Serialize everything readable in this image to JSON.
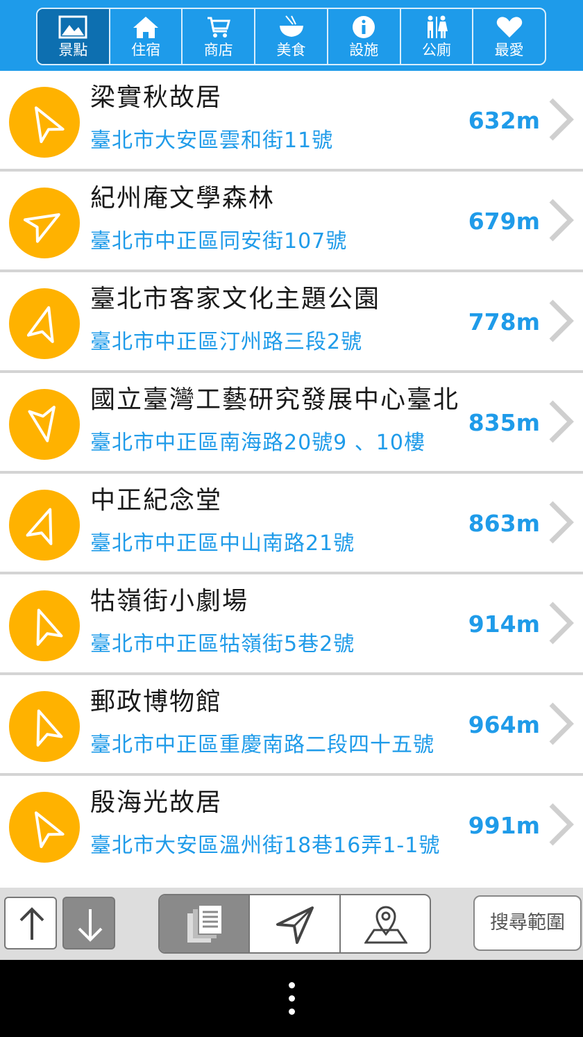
{
  "tabs": [
    {
      "label": "景點",
      "icon": "landscape-icon",
      "active": true
    },
    {
      "label": "住宿",
      "icon": "home-icon",
      "active": false
    },
    {
      "label": "商店",
      "icon": "cart-icon",
      "active": false
    },
    {
      "label": "美食",
      "icon": "bowl-icon",
      "active": false
    },
    {
      "label": "設施",
      "icon": "info-icon",
      "active": false
    },
    {
      "label": "公廁",
      "icon": "restroom-icon",
      "active": false
    },
    {
      "label": "最愛",
      "icon": "heart-icon",
      "active": false
    }
  ],
  "places": [
    {
      "name": "梁實秋故居",
      "address": "臺北市大安區雲和街11號",
      "distance": "632m",
      "direction_deg": -30
    },
    {
      "name": "紀州庵文學森林",
      "address": "臺北市中正區同安街107號",
      "distance": "679m",
      "direction_deg": 60
    },
    {
      "name": "臺北市客家文化主題公園",
      "address": "臺北市中正區汀州路三段2號",
      "distance": "778m",
      "direction_deg": 15
    },
    {
      "name": "國立臺灣工藝研究發展中心臺北",
      "address": "臺北市中正區南海路20號9 、10樓",
      "distance": "835m",
      "direction_deg": 170
    },
    {
      "name": "中正紀念堂",
      "address": "臺北市中正區中山南路21號",
      "distance": "863m",
      "direction_deg": 20
    },
    {
      "name": "牯嶺街小劇場",
      "address": "臺北市中正區牯嶺街5巷2號",
      "distance": "914m",
      "direction_deg": -20
    },
    {
      "name": "郵政博物館",
      "address": "臺北市中正區重慶南路二段四十五號",
      "distance": "964m",
      "direction_deg": -20
    },
    {
      "name": "殷海光故居",
      "address": "臺北市大安區溫州街18巷16弄1-1號",
      "distance": "991m",
      "direction_deg": -30
    }
  ],
  "toolbar": {
    "scroll_up_icon": "arrow-up-icon",
    "scroll_down_icon": "arrow-down-icon",
    "segments": [
      {
        "icon": "list-icon",
        "active": true
      },
      {
        "icon": "navigation-icon",
        "active": false
      },
      {
        "icon": "map-pin-icon",
        "active": false
      }
    ],
    "range_label": "搜尋範圍"
  },
  "colors": {
    "header_blue": "#1e9bea",
    "active_tab": "#0d6fb0",
    "pin_orange": "#ffb200",
    "link_blue": "#1f9be9"
  }
}
